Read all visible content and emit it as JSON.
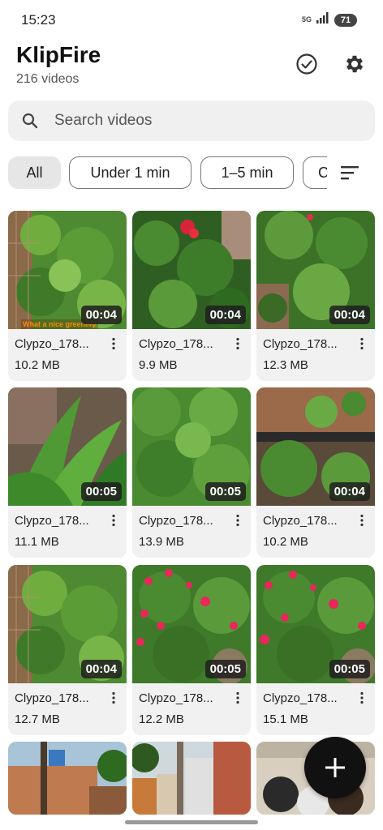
{
  "status_bar": {
    "time": "15:23",
    "network_label": "5G",
    "battery": "71",
    "icons": [
      "signal-icon",
      "battery-icon"
    ]
  },
  "header": {
    "title": "KlipFire",
    "subtitle": "216 videos",
    "actions": [
      "check-circle-icon",
      "gear-icon"
    ]
  },
  "search": {
    "placeholder": "Search videos",
    "icon": "search-icon"
  },
  "filters": {
    "chips": [
      {
        "label": "All",
        "active": true
      },
      {
        "label": "Under 1 min",
        "active": false
      },
      {
        "label": "1–5 min",
        "active": false
      },
      {
        "label": "C",
        "active": false
      }
    ],
    "sort_icon": "sort-icon"
  },
  "videos": [
    {
      "name": "Clypzo_178...",
      "size": "10.2 MB",
      "duration": "00:04",
      "overlay_text": "What a nice greenery"
    },
    {
      "name": "Clypzo_178...",
      "size": "9.9 MB",
      "duration": "00:04"
    },
    {
      "name": "Clypzo_178...",
      "size": "12.3 MB",
      "duration": "00:04"
    },
    {
      "name": "Clypzo_178...",
      "size": "11.1 MB",
      "duration": "00:05"
    },
    {
      "name": "Clypzo_178...",
      "size": "13.9 MB",
      "duration": "00:05"
    },
    {
      "name": "Clypzo_178...",
      "size": "10.2 MB",
      "duration": "00:04"
    },
    {
      "name": "Clypzo_178...",
      "size": "12.7 MB",
      "duration": "00:04"
    },
    {
      "name": "Clypzo_178...",
      "size": "12.2 MB",
      "duration": "00:05"
    },
    {
      "name": "Clypzo_178...",
      "size": "15.1 MB",
      "duration": "00:05"
    }
  ],
  "fab_icon": "plus-icon",
  "colors": {
    "foliage": "#3f7a2a",
    "foliage_light": "#6fae3e",
    "flower_red": "#e8275a",
    "fab": "#111111"
  }
}
